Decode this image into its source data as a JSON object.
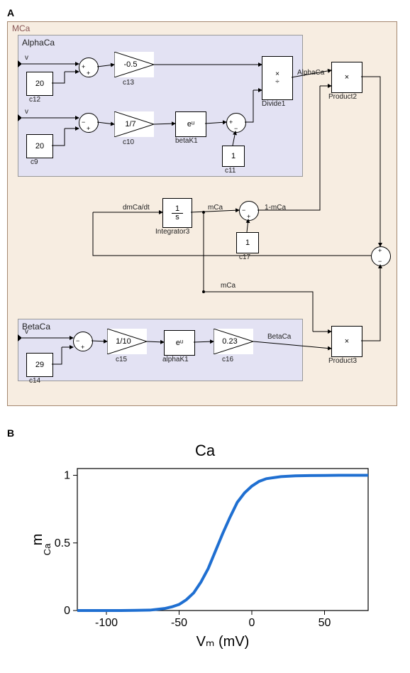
{
  "panelA": {
    "label": "A",
    "system_label": "MCa",
    "alpha_label": "AlphaCa",
    "beta_label": "BetaCa",
    "blocks": {
      "c12_val": "20",
      "c12_name": "c12",
      "c9_val": "20",
      "c9_name": "c9",
      "c13_gain": "-0.5",
      "c13_name": "c13",
      "c10_gain": "1/7",
      "c10_name": "c10",
      "betaK1_label": "eᵘ",
      "betaK1_name": "betaK1",
      "c11_val": "1",
      "c11_name": "c11",
      "divide1_name": "Divide1",
      "product2_name": "Product2",
      "integrator3_label": "1/s",
      "integrator3_name": "Integrator3",
      "dmdt_label": "dmCa/dt",
      "mca_label": "mCa",
      "one_minus_mca": "1-mCa",
      "c17_val": "1",
      "c17_name": "c17",
      "c14_val": "29",
      "c14_name": "c14",
      "c15_gain": "1/10",
      "c15_name": "c15",
      "alphaK1_label": "eᵘ",
      "alphaK1_name": "alphaK1",
      "c16_gain": "0.23",
      "c16_name": "c16",
      "betaCa_signal": "BetaCa",
      "alphaCa_signal": "AlphaCa",
      "product3_name": "Product3",
      "v_label": "v"
    }
  },
  "panelB": {
    "label": "B",
    "title": "Ca",
    "xlabel": "Vₘ (mV)",
    "ylabel": "m_Ca"
  },
  "chart_data": {
    "type": "line",
    "title": "Ca",
    "xlabel": "Vm (mV)",
    "ylabel": "m_Ca",
    "xlim": [
      -120,
      80
    ],
    "ylim": [
      0,
      1.05
    ],
    "xticks": [
      -100,
      -50,
      0,
      50
    ],
    "yticks": [
      0,
      0.5,
      1
    ],
    "x": [
      -120,
      -110,
      -100,
      -90,
      -80,
      -70,
      -60,
      -55,
      -50,
      -45,
      -40,
      -35,
      -30,
      -25,
      -20,
      -15,
      -10,
      -5,
      0,
      5,
      10,
      20,
      30,
      40,
      50,
      60,
      70,
      80
    ],
    "y": [
      0.0,
      0.0,
      0.0,
      0.0,
      0.001,
      0.003,
      0.015,
      0.027,
      0.045,
      0.08,
      0.13,
      0.21,
      0.31,
      0.44,
      0.57,
      0.69,
      0.8,
      0.87,
      0.92,
      0.955,
      0.975,
      0.99,
      0.996,
      0.998,
      0.999,
      1.0,
      1.0,
      1.0
    ]
  }
}
